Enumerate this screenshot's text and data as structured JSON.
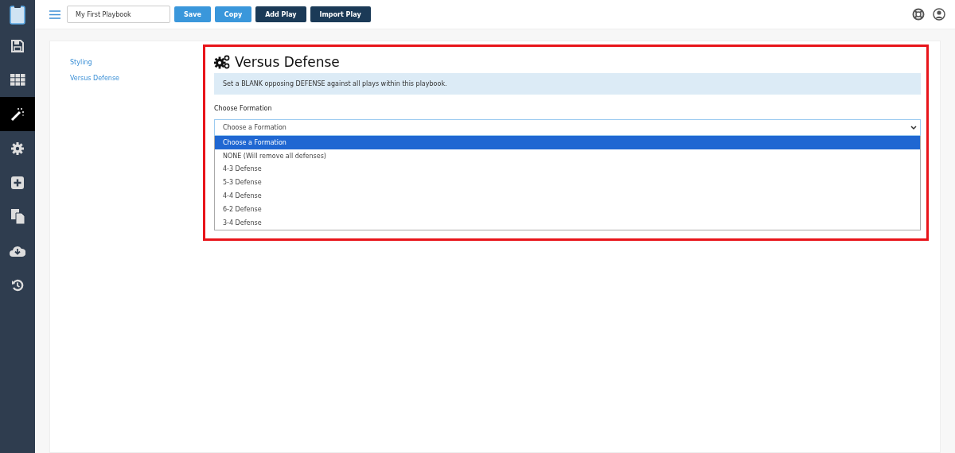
{
  "sidebar": {
    "items": [
      {
        "kind": "save",
        "selected": false
      },
      {
        "kind": "grid",
        "selected": false
      },
      {
        "kind": "wand",
        "selected": true
      },
      {
        "kind": "gear",
        "selected": false
      },
      {
        "kind": "plus",
        "selected": false
      },
      {
        "kind": "copy",
        "selected": false
      },
      {
        "kind": "download",
        "selected": false
      },
      {
        "kind": "history",
        "selected": false
      }
    ]
  },
  "toolbar": {
    "playbook_name": "My First Playbook",
    "buttons": [
      {
        "label": "Save",
        "kind": "light"
      },
      {
        "label": "Copy",
        "kind": "light"
      },
      {
        "label": "Add Play",
        "kind": "dark"
      },
      {
        "label": "Import Play",
        "kind": "dark"
      }
    ]
  },
  "nav": [
    {
      "label": "Styling"
    },
    {
      "label": "Versus Defense"
    }
  ],
  "panel": {
    "title": "Versus Defense",
    "info": "Set a BLANK opposing DEFENSE against all plays within this playbook.",
    "field_label": "Choose Formation",
    "select_value": "Choose a Formation",
    "options": [
      {
        "label": "Choose a Formation",
        "selected": true
      },
      {
        "label": "NONE (Will remove all defenses)",
        "selected": false
      },
      {
        "label": "4-3 Defense",
        "selected": false
      },
      {
        "label": "5-3 Defense",
        "selected": false
      },
      {
        "label": "4-4 Defense",
        "selected": false
      },
      {
        "label": "6-2 Defense",
        "selected": false
      },
      {
        "label": "3-4 Defense",
        "selected": false
      }
    ]
  }
}
